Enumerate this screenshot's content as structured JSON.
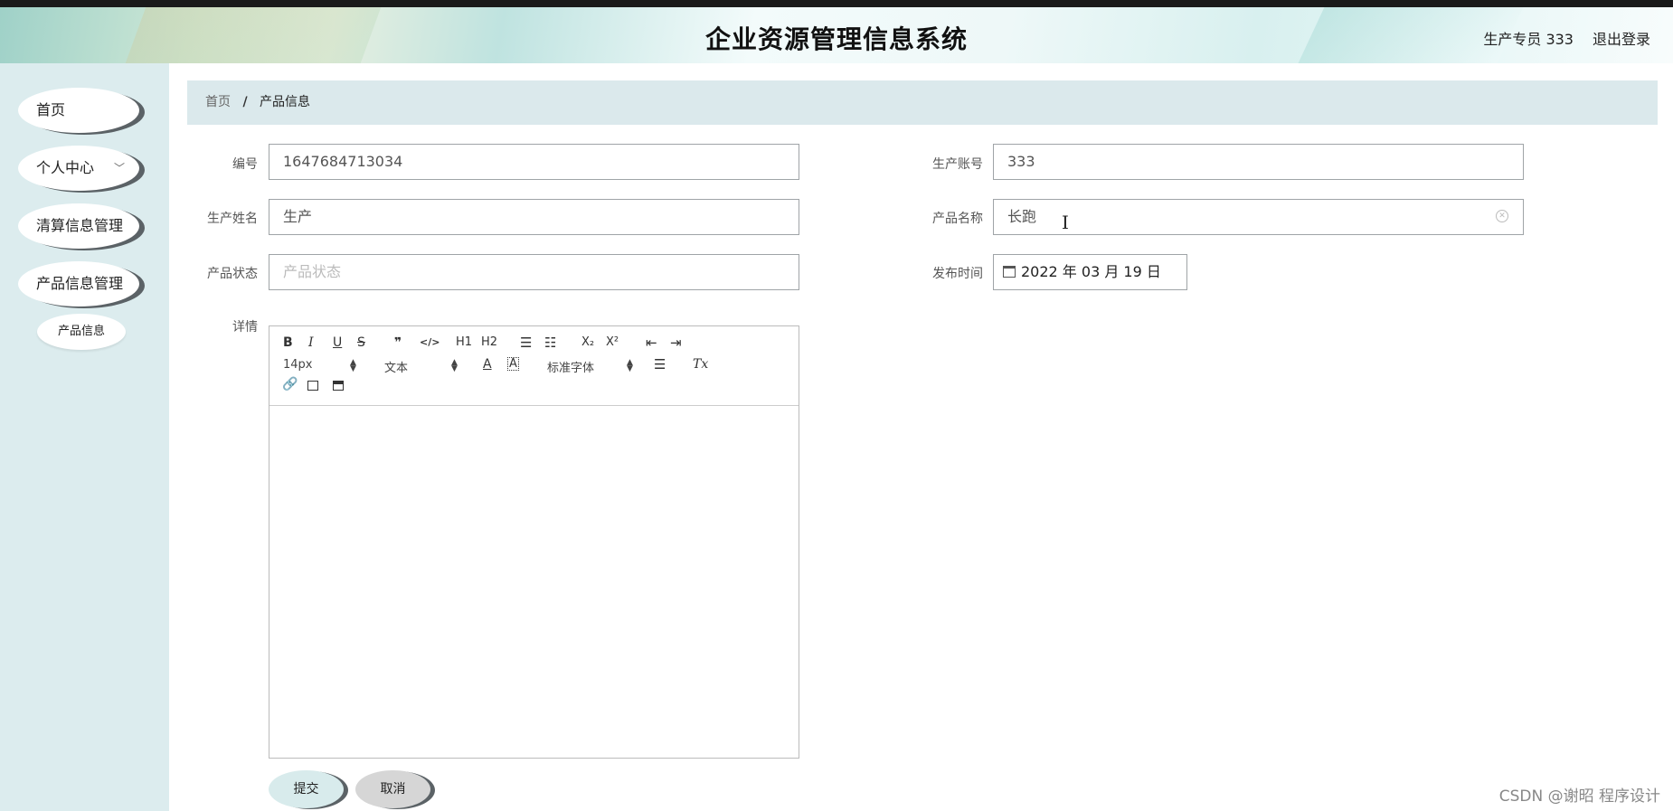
{
  "header": {
    "title": "企业资源管理信息系统",
    "user": "生产专员 333",
    "logout": "退出登录"
  },
  "sidebar": {
    "items": [
      {
        "label": "首页"
      },
      {
        "label": "个人中心",
        "icon": "chevron-down-icon"
      },
      {
        "label": "清算信息管理"
      },
      {
        "label": "产品信息管理"
      }
    ],
    "sub_items": [
      {
        "label": "产品信息"
      }
    ]
  },
  "breadcrumb": {
    "home": "首页",
    "separator": "/",
    "current": "产品信息"
  },
  "form": {
    "bianhao": {
      "label": "编号",
      "value": "1647684713034"
    },
    "account": {
      "label": "生产账号",
      "value": "333"
    },
    "name": {
      "label": "生产姓名",
      "value": "生产"
    },
    "product_name": {
      "label": "产品名称",
      "value": "长跑"
    },
    "status": {
      "label": "产品状态",
      "placeholder": "产品状态"
    },
    "publish_time": {
      "label": "发布时间",
      "value": "2022 年 03 月 19 日"
    },
    "detail": {
      "label": "详情"
    }
  },
  "editor": {
    "toolbar_row1": [
      "B",
      "I",
      "U",
      "S",
      "❞",
      "</>",
      "H1",
      "H2",
      "ordered-list",
      "bullet-list",
      "X₂",
      "X²",
      "outdent",
      "indent"
    ],
    "font_size": "14px",
    "header_select": "文本",
    "font_color": "A",
    "font_family": "标准字体",
    "clean": "Tx"
  },
  "buttons": {
    "submit": "提交",
    "cancel": "取消"
  },
  "watermark": "CSDN @谢昭  程序设计"
}
